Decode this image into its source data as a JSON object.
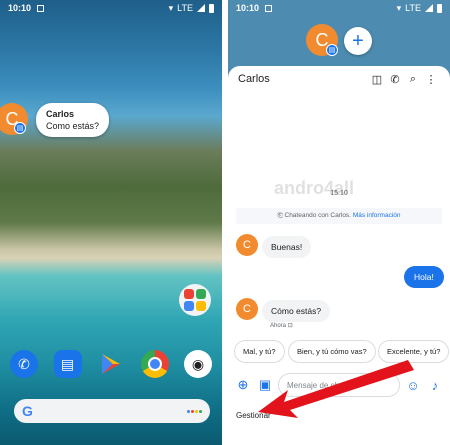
{
  "left_screen": {
    "status_time": "10:10",
    "network": "LTE",
    "chat_head_initial": "C",
    "preview": {
      "name": "Carlos",
      "message": "Como estás?"
    },
    "dock_apps": [
      "phone-app",
      "messages-app",
      "play-store-app",
      "chrome-app",
      "camera-app"
    ],
    "search_logo": "G"
  },
  "right_screen": {
    "status_time": "10:10",
    "network": "LTE",
    "bubble_initial": "C",
    "add_label": "+",
    "conversation": {
      "title": "Carlos",
      "timestamp": "15:10",
      "info_text": "Chateando con Carlos.",
      "info_link": "Más información",
      "messages": [
        {
          "direction": "in",
          "text": "Buenas!"
        },
        {
          "direction": "out",
          "text": "Hola!"
        },
        {
          "direction": "in",
          "text": "Cómo estás?",
          "meta": "Ahora"
        }
      ],
      "suggestions": [
        "Mal, y tú?",
        "Bien, y tú cómo vas?",
        "Excelente, y tú?"
      ],
      "compose_placeholder": "Mensaje de chat",
      "avatar_initial": "C"
    },
    "manage_label": "Gestionar",
    "watermark": "andro4all"
  },
  "colors": {
    "accent": "#1a73e8",
    "avatar": "#f28b30",
    "arrow": "#e3131b"
  }
}
